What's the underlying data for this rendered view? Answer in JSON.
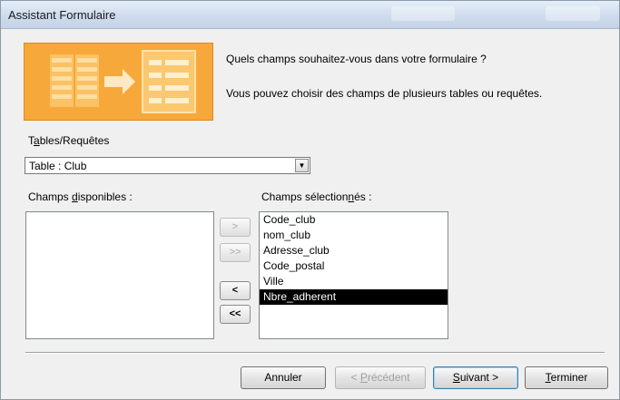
{
  "window": {
    "title": "Assistant Formulaire"
  },
  "intro": {
    "question": "Quels champs souhaitez-vous dans votre formulaire ?",
    "hint": "Vous pouvez choisir des champs de plusieurs tables ou requêtes."
  },
  "tables": {
    "label_pre": "T",
    "label_u": "a",
    "label_post": "bles/Requêtes",
    "selected": "Table : Club"
  },
  "available": {
    "label_pre": "Champs ",
    "label_u": "d",
    "label_post": "isponibles :",
    "items": []
  },
  "selected_fields": {
    "label_pre": "Champs sélection",
    "label_u": "n",
    "label_post": "és :",
    "items": [
      "Code_club",
      "nom_club",
      "Adresse_club",
      "Code_postal",
      "Ville",
      "Nbre_adherent"
    ],
    "highlighted": "Nbre_adherent"
  },
  "move_buttons": {
    "add_one": ">",
    "add_all": ">>",
    "remove_one": "<",
    "remove_all": "<<"
  },
  "footer": {
    "cancel": "Annuler",
    "prev_pre": "< ",
    "prev_u": "P",
    "prev_post": "récédent",
    "next_u": "S",
    "next_post": "uivant >",
    "finish_u": "T",
    "finish_post": "erminer"
  }
}
